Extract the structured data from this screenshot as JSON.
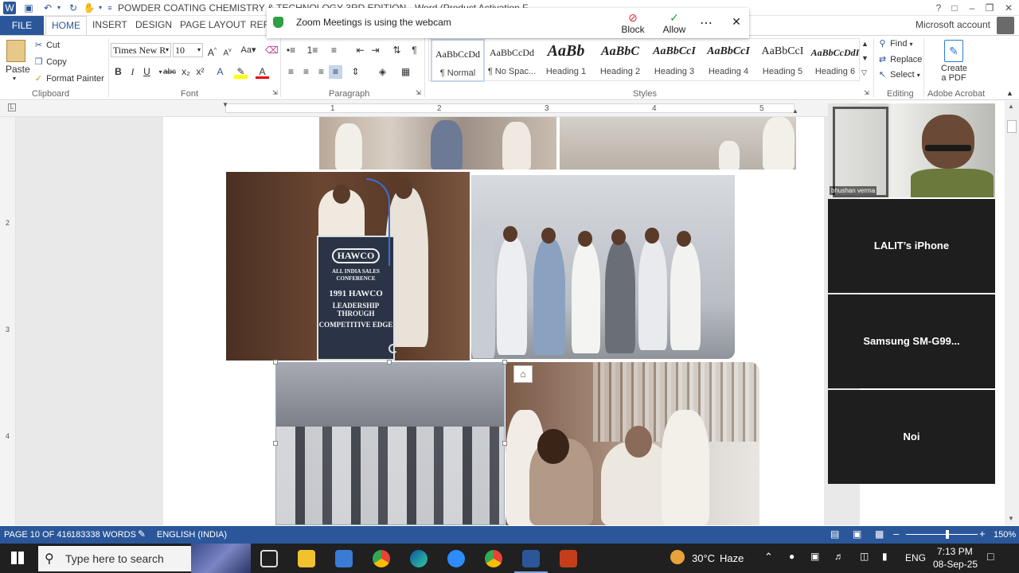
{
  "window": {
    "title": "POWDER COATING CHEMISTRY & TECHNOLOGY 3RD EDITION - Word (Product Activation F...",
    "account_label": "Microsoft account"
  },
  "ribbon_tabs": [
    "FILE",
    "HOME",
    "INSERT",
    "DESIGN",
    "PAGE LAYOUT",
    "REFE"
  ],
  "clipboard": {
    "paste": "Paste",
    "cut": "Cut",
    "copy": "Copy",
    "format_painter": "Format Painter",
    "group": "Clipboard"
  },
  "font": {
    "family": "Times New R",
    "size": "10",
    "group": "Font",
    "bold": "B",
    "italic": "I",
    "underline": "U",
    "strike": "abc",
    "sub": "x₂",
    "sup": "x²"
  },
  "paragraph": {
    "group": "Paragraph"
  },
  "styles": {
    "group": "Styles",
    "items": [
      {
        "preview": "AaBbCcDd",
        "label": "¶ Normal"
      },
      {
        "preview": "AaBbCcDd",
        "label": "¶ No Spac..."
      },
      {
        "preview": "AaBb",
        "label": "Heading 1"
      },
      {
        "preview": "AaBbC",
        "label": "Heading 2"
      },
      {
        "preview": "AaBbCcI",
        "label": "Heading 3"
      },
      {
        "preview": "AaBbCcI",
        "label": "Heading 4"
      },
      {
        "preview": "AaBbCcI",
        "label": "Heading 5"
      },
      {
        "preview": "AaBbCcDdI",
        "label": "Heading 6"
      }
    ]
  },
  "editing": {
    "find": "Find",
    "replace": "Replace",
    "select": "Select",
    "group": "Editing"
  },
  "acrobat": {
    "create_line1": "Create",
    "create_line2": "a PDF",
    "group": "Adobe Acrobat"
  },
  "zoom_notice": {
    "app": "Zoom Meetings",
    "message": " is using the webcam",
    "block": "Block",
    "allow": "Allow"
  },
  "ruler": {
    "marks": [
      "1",
      "2",
      "3",
      "4",
      "5"
    ],
    "vmarks": [
      "2",
      "3",
      "4"
    ]
  },
  "document": {
    "banner_text": [
      "HAWCO",
      "ALL INDIA SALES CONFERENCE",
      "1991 HAWCO",
      "LEADERSHIP THROUGH",
      "COMPETITIVE EDGE"
    ]
  },
  "zoom_participants": [
    {
      "name": "bhushan verma"
    },
    {
      "name": "LALIT’s iPhone"
    },
    {
      "name": "Samsung  SM-G99..."
    },
    {
      "name": "Noi"
    }
  ],
  "status": {
    "page": "PAGE 10 OF 416",
    "words": "183338 WORDS",
    "language": "ENGLISH (INDIA)",
    "zoom": "150%",
    "zoom_level": 0.58
  },
  "taskbar": {
    "search_placeholder": "Type here to search",
    "weather_temp": "30°C",
    "weather_cond": "Haze",
    "lang": "ENG",
    "time": "7:13 PM",
    "date": "08-Sep-25"
  }
}
